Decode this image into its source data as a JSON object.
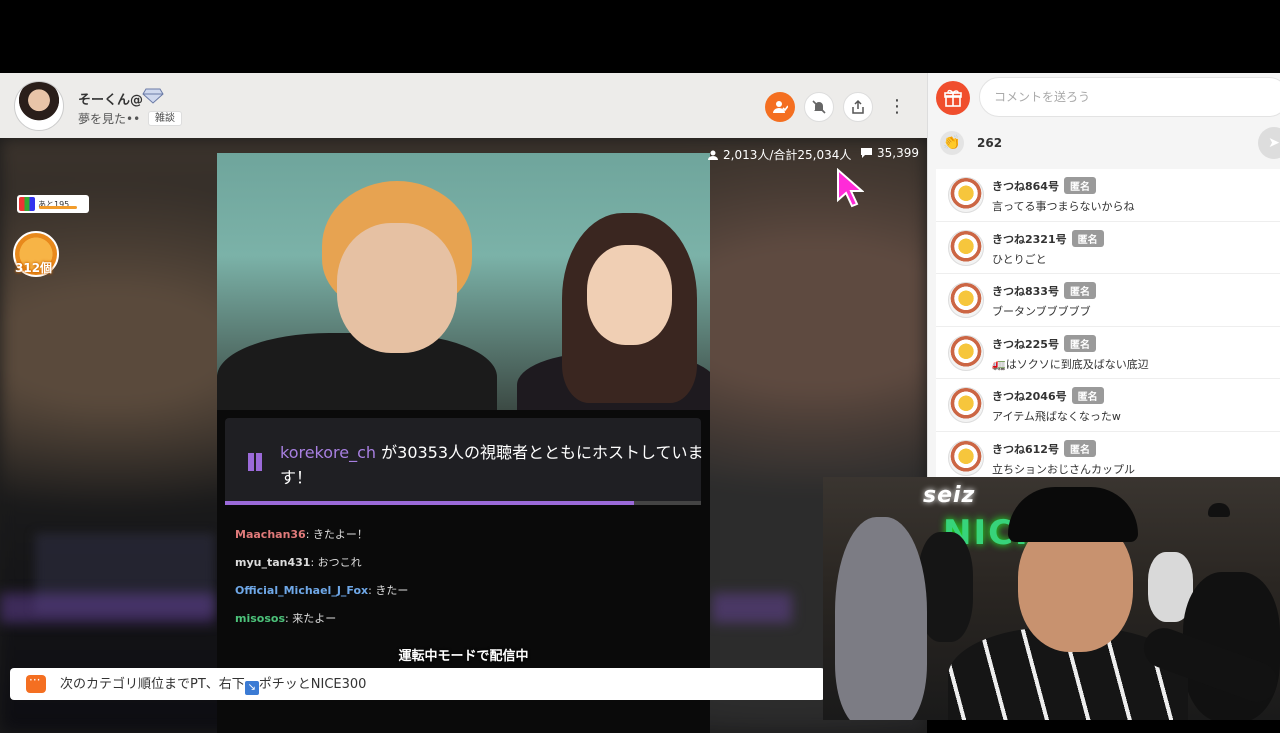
{
  "header": {
    "host_name": "そーくん@",
    "live_title": "夢を見た••",
    "category": "雑談"
  },
  "video": {
    "viewer_stats": "2,013人/合計25,034人",
    "comment_count": "35,399",
    "event_label": "あと195",
    "gift_count": "312個",
    "host_notice": {
      "user": "korekore_ch",
      "text": " が30353人の視聴者とともにホストしています！"
    },
    "chat_lines": [
      {
        "name": "Maachan36",
        "text": "きたよー！",
        "color": "#e07a7a"
      },
      {
        "name": "myu_tan431",
        "text": "おつこれ",
        "color": "#dddddd"
      },
      {
        "name": "Official_Michael_J_Fox",
        "text": "きたー",
        "color": "#6fa8e8"
      },
      {
        "name": "misosos",
        "text": "来たよー",
        "color": "#4cc27a"
      }
    ],
    "caption": "運転中モードで配信中"
  },
  "info_bar": {
    "text_before": "次のカテゴリ順位までPT、右下",
    "arrow": "↘",
    "text_after": "ポチッとNICE300"
  },
  "panel": {
    "comment_placeholder": "コメントを送ろう",
    "clap_count": "262",
    "comments": [
      {
        "name": "きつね864号",
        "badge": "匿名",
        "text": "言ってる事つまらないからね"
      },
      {
        "name": "きつね2321号",
        "badge": "匿名",
        "text": "ひとりごと"
      },
      {
        "name": "きつね833号",
        "badge": "匿名",
        "text": "ブータンブブブブブ"
      },
      {
        "name": "きつね225号",
        "badge": "匿名",
        "text": "🚛はソクソに到底及ばない底辺"
      },
      {
        "name": "きつね2046号",
        "badge": "匿名",
        "text": "アイテム飛ばなくなったw"
      },
      {
        "name": "きつね612号",
        "badge": "匿名",
        "text": "立ちションおじさんカップル"
      }
    ]
  },
  "webcam": {
    "logo_text": "seiz",
    "neon_text": "NICK"
  },
  "colors": {
    "accent": "#f46f21",
    "gift": "#f04e2d",
    "twitch_purple": "#9b6ad9"
  }
}
